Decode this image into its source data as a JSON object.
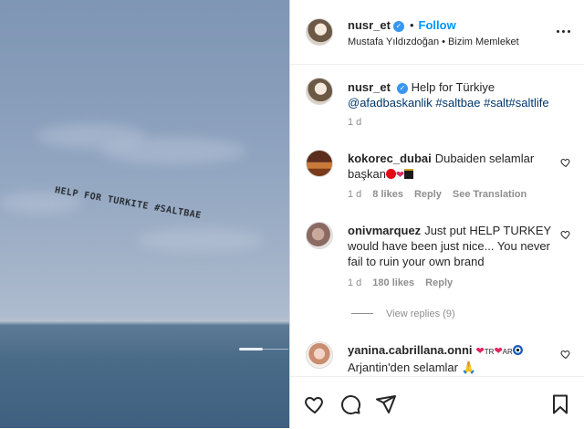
{
  "photo": {
    "banner_text": "HELP FOR TURKITE #SALTBAE"
  },
  "header": {
    "username": "nusr_et",
    "separator": "•",
    "follow_label": "Follow",
    "subtitle": "Mustafa Yıldızdoğan • Bizim Memleket"
  },
  "caption": {
    "username": "nusr_et",
    "text": "Help for Türkiye",
    "mention": "@afadbaskanlik",
    "hashtags": "#saltbae #salt#saltlife",
    "time": "1 d"
  },
  "comments": [
    {
      "username": "kokorec_dubai",
      "text": "Dubaiden selamlar başkan",
      "time": "1 d",
      "likes": "8 likes",
      "reply_label": "Reply",
      "translation_label": "See Translation"
    },
    {
      "username": "onivmarquez",
      "text": "Just put HELP TURKEY would have been just nice... You never fail to ruin your own brand",
      "time": "1 d",
      "likes": "180 likes",
      "reply_label": "Reply",
      "view_replies": "View replies (9)"
    },
    {
      "username": "yanina.cabrillana.onni",
      "flag_tr": "TR",
      "flag_ar": "AR",
      "text": "Arjantin'den selamlar"
    }
  ],
  "colors": {
    "link_blue": "#0095f6",
    "mention_blue": "#00376b",
    "muted": "#8e8e8e",
    "heart_red": "#e0245e"
  },
  "icons": [
    "more-options-icon",
    "verified-badge-icon",
    "heart-icon",
    "comment-icon",
    "share-icon",
    "bookmark-icon"
  ]
}
